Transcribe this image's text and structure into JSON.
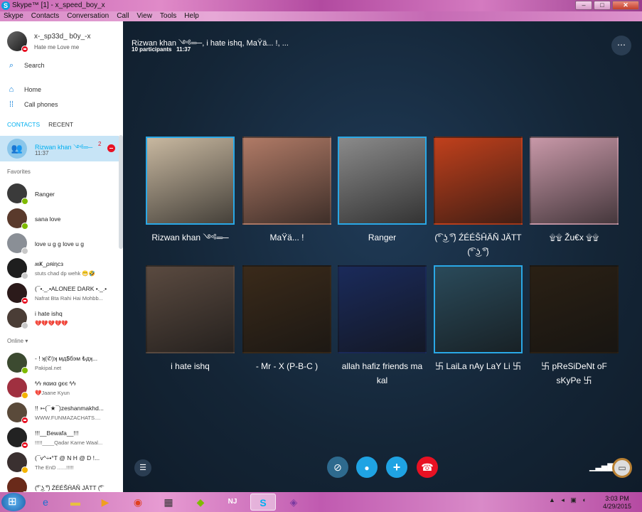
{
  "window": {
    "title": "Skype™ [1] - x_speed_boy_x",
    "minimize": "–",
    "maximize": "□",
    "close": "✕"
  },
  "menu": [
    "Skype",
    "Contacts",
    "Conversation",
    "Call",
    "View",
    "Tools",
    "Help"
  ],
  "profile": {
    "name": "x-_sp33d_ b0y_-x",
    "mood": "Hate me Love me",
    "status": "dnd"
  },
  "nav": {
    "search": "Search",
    "home": "Home",
    "call_phones": "Call phones"
  },
  "tabs": {
    "contacts": "CONTACTS",
    "recent": "RECENT"
  },
  "active_conversation": {
    "name": "Rizwan khan ༺═─",
    "time": "11:37",
    "unread": "2"
  },
  "sections": {
    "favorites": "Favorites",
    "online": "Online ▾"
  },
  "favorites": [
    {
      "name": "Ranger",
      "mood": "",
      "status": "online",
      "color": "#3a3a3a"
    },
    {
      "name": "sana love",
      "mood": "",
      "status": "online",
      "color": "#5a3a2c"
    },
    {
      "name": "love u g g love u g",
      "mood": "",
      "status": "offline",
      "color": "#8a8f96"
    },
    {
      "name": "ʍҜ_ρяiηcз",
      "mood": "stuts chad dp wehk 😁🤣",
      "status": "offline",
      "color": "#1e1e1e"
    },
    {
      "name": "(¯•._.•ALONEE DARK •._.•",
      "mood": "Nafrat Bta Rahi Hai Mohbb...",
      "status": "dnd",
      "color": "#2b1a1a"
    },
    {
      "name": "i hate ishq",
      "mood": "💔💔💔💔💔",
      "status": "offline",
      "color": "#4a3d36"
    }
  ],
  "online": [
    {
      "name": "- ! ʞ(✆)ʞ мд$бэм ₺дʞ...",
      "mood": "Pakipal.net",
      "status": "online",
      "color": "#3c4a30"
    },
    {
      "name": "ϟϟ яαиα gєє ϟϟ",
      "mood": "💔Jaane Kyun",
      "status": "away",
      "color": "#a03040"
    },
    {
      "name": "!! ➳(¯★¯)zeshanmakhd...",
      "mood": "WWW.FUNMAZACHATS....",
      "status": "dnd",
      "color": "#5a4a3a"
    },
    {
      "name": "!!!__Bewafa__!!!",
      "mood": "!!!!!____Qadar Karne Waal...",
      "status": "dnd",
      "color": "#222222"
    },
    {
      "name": "(¯v^÷•°T @ N H @ D !...",
      "mood": "The EnD ......!!!!!",
      "status": "away",
      "color": "#3a3030"
    },
    {
      "name": "(͡° ͜ʖ ͡°) ŹÉÉŠĤÄÑ JÄTT (͡°",
      "mood": "",
      "status": "away",
      "color": "#6a2a1a"
    }
  ],
  "conversation": {
    "title": "Rizwan khan ༺═─, i hate ishq, MaŸä... !, ...",
    "participants": "10 participants",
    "time": "11:37",
    "more": "⋯"
  },
  "participants": [
    {
      "name": "Rizwan khan ༺═─",
      "speaking": true,
      "icon": "person-standing-photo",
      "color": "#c8b8a0"
    },
    {
      "name": "MaŸä... !",
      "speaking": false,
      "icon": "woman-photo",
      "color": "#b07a66"
    },
    {
      "name": "Ranger",
      "speaking": true,
      "icon": "man-hat-photo",
      "color": "#8a8a8a"
    },
    {
      "name": "(͡° ͜ʖ ͡°) ŹÉÉŠĤÄÑ JÄTT (͡° ͜ʖ ͡°)",
      "speaking": false,
      "icon": "tiger-photo",
      "color": "#c0401c"
    },
    {
      "name": "۩۩ Žu€x ۩۩",
      "speaking": false,
      "icon": "man-photo",
      "color": "#c898a8"
    },
    {
      "name": "i hate ishq",
      "speaking": false,
      "icon": "arm-photo",
      "color": "#5a4a40"
    },
    {
      "name": "-      Mr - X      (P-B-C )",
      "speaking": false,
      "icon": "gunman-photo",
      "color": "#3a2a1a"
    },
    {
      "name": "allah hafiz friends ma kal",
      "speaking": false,
      "icon": "dancer-photo",
      "color": "#1a2a5a"
    },
    {
      "name": "卐 LaiLa nAy LaY Li 卐",
      "speaking": true,
      "icon": "crack-logo",
      "color": "#2a4a5a"
    },
    {
      "name": "卐 pReSiDeNt oF sKyPe 卐",
      "speaking": false,
      "icon": "dark-room-photo",
      "color": "#2a2014"
    }
  ],
  "call_controls": {
    "list": "☰",
    "video": "⊘",
    "mic": "🎤",
    "add": "+",
    "end": "☎",
    "signal": "📶",
    "chat": "💬"
  },
  "taskbar": {
    "apps": [
      "ie",
      "explorer",
      "media-player",
      "chrome",
      "app-grid",
      "app-green",
      "nj",
      "skype",
      "app-purple"
    ],
    "time": "3:03 PM",
    "date": "4/29/2015"
  },
  "colors": {
    "skype_blue": "#00aff0",
    "speaking_border": "#2aa8e6",
    "end_call": "#e81123",
    "control_blue": "#1fa3e3"
  }
}
